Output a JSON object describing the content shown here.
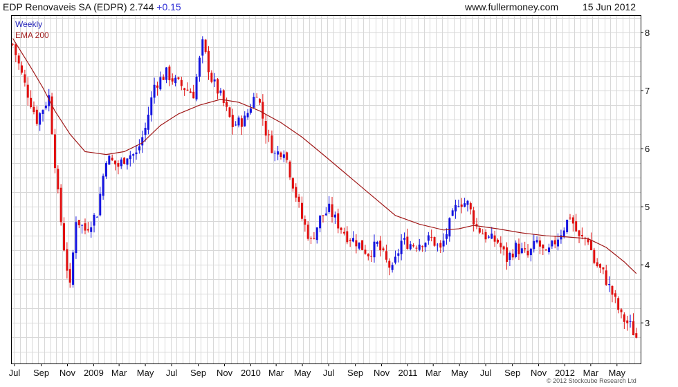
{
  "header": {
    "title": "EDP Renovaveis SA (EDPR) 2.744",
    "change": "+0.15",
    "site": "www.fullermoney.com",
    "date": "15 Jun 2012"
  },
  "legend": {
    "interval": "Weekly",
    "ema": "EMA 200"
  },
  "footer": {
    "copyright": "© 2012 Stockcube Research Ltd"
  },
  "colors": {
    "up": "#1414e0",
    "down": "#e01010",
    "ema": "#a01818",
    "grid": "#d8d8d8",
    "axis": "#000000"
  },
  "chart_data": {
    "type": "candlestick",
    "title": "EDP Renovaveis SA (EDPR) 2.744",
    "interval": "Weekly",
    "ylim": [
      2.3,
      8.3
    ],
    "y_ticks": [
      3,
      4,
      5,
      6,
      7,
      8
    ],
    "x_range": [
      "2008-06-23",
      "2012-06-25"
    ],
    "x_ticks": [
      {
        "label": "Jul",
        "date": "2008-07-01"
      },
      {
        "label": "Sep",
        "date": "2008-09-01"
      },
      {
        "label": "Nov",
        "date": "2008-11-01"
      },
      {
        "label": "2009",
        "date": "2009-01-01"
      },
      {
        "label": "Mar",
        "date": "2009-03-01"
      },
      {
        "label": "May",
        "date": "2009-05-01"
      },
      {
        "label": "Jul",
        "date": "2009-07-01"
      },
      {
        "label": "Sep",
        "date": "2009-09-01"
      },
      {
        "label": "Nov",
        "date": "2009-11-01"
      },
      {
        "label": "2010",
        "date": "2010-01-01"
      },
      {
        "label": "Mar",
        "date": "2010-03-01"
      },
      {
        "label": "May",
        "date": "2010-05-01"
      },
      {
        "label": "Jul",
        "date": "2010-07-01"
      },
      {
        "label": "Sep",
        "date": "2010-09-01"
      },
      {
        "label": "Nov",
        "date": "2010-11-01"
      },
      {
        "label": "2011",
        "date": "2011-01-01"
      },
      {
        "label": "Mar",
        "date": "2011-03-01"
      },
      {
        "label": "May",
        "date": "2011-05-01"
      },
      {
        "label": "Jul",
        "date": "2011-07-01"
      },
      {
        "label": "Sep",
        "date": "2011-09-01"
      },
      {
        "label": "Nov",
        "date": "2011-11-01"
      },
      {
        "label": "2012",
        "date": "2012-01-01"
      },
      {
        "label": "Mar",
        "date": "2012-03-01"
      },
      {
        "label": "May",
        "date": "2012-05-01"
      }
    ],
    "anchor_closes": [
      [
        "2008-06-27",
        7.8
      ],
      [
        "2008-07-25",
        7.1
      ],
      [
        "2008-08-22",
        6.5
      ],
      [
        "2008-09-19",
        6.9
      ],
      [
        "2008-10-10",
        5.2
      ],
      [
        "2008-10-24",
        4.3
      ],
      [
        "2008-11-07",
        3.6
      ],
      [
        "2008-11-21",
        4.8
      ],
      [
        "2008-12-12",
        4.6
      ],
      [
        "2009-01-09",
        4.9
      ],
      [
        "2009-01-30",
        5.85
      ],
      [
        "2009-02-27",
        5.7
      ],
      [
        "2009-03-20",
        5.9
      ],
      [
        "2009-04-10",
        5.9
      ],
      [
        "2009-05-01",
        6.35
      ],
      [
        "2009-05-22",
        7.1
      ],
      [
        "2009-06-19",
        7.3
      ],
      [
        "2009-07-10",
        7.15
      ],
      [
        "2009-07-31",
        7.05
      ],
      [
        "2009-08-21",
        6.95
      ],
      [
        "2009-09-11",
        7.8
      ],
      [
        "2009-10-02",
        7.2
      ],
      [
        "2009-10-23",
        6.9
      ],
      [
        "2009-11-20",
        6.4
      ],
      [
        "2009-12-18",
        6.5
      ],
      [
        "2010-01-15",
        7.0
      ],
      [
        "2010-02-05",
        6.3
      ],
      [
        "2010-02-26",
        5.9
      ],
      [
        "2010-03-19",
        6.0
      ],
      [
        "2010-04-09",
        5.4
      ],
      [
        "2010-04-30",
        4.8
      ],
      [
        "2010-05-21",
        4.4
      ],
      [
        "2010-06-11",
        4.8
      ],
      [
        "2010-07-02",
        4.95
      ],
      [
        "2010-07-23",
        4.7
      ],
      [
        "2010-08-13",
        4.5
      ],
      [
        "2010-09-03",
        4.4
      ],
      [
        "2010-10-01",
        4.2
      ],
      [
        "2010-10-22",
        4.35
      ],
      [
        "2010-11-12",
        4.05
      ],
      [
        "2010-11-26",
        3.9
      ],
      [
        "2010-12-17",
        4.4
      ],
      [
        "2011-01-14",
        4.35
      ],
      [
        "2011-02-04",
        4.4
      ],
      [
        "2011-02-25",
        4.45
      ],
      [
        "2011-03-18",
        4.25
      ],
      [
        "2011-04-08",
        4.7
      ],
      [
        "2011-04-29",
        5.1
      ],
      [
        "2011-05-20",
        5.05
      ],
      [
        "2011-06-10",
        4.65
      ],
      [
        "2011-07-08",
        4.45
      ],
      [
        "2011-07-29",
        4.4
      ],
      [
        "2011-08-19",
        4.1
      ],
      [
        "2011-09-09",
        4.3
      ],
      [
        "2011-10-07",
        4.15
      ],
      [
        "2011-10-28",
        4.4
      ],
      [
        "2011-11-18",
        4.15
      ],
      [
        "2011-12-09",
        4.4
      ],
      [
        "2011-12-30",
        4.65
      ],
      [
        "2012-01-13",
        4.85
      ],
      [
        "2012-02-03",
        4.45
      ],
      [
        "2012-02-24",
        4.45
      ],
      [
        "2012-03-09",
        4.05
      ],
      [
        "2012-03-30",
        3.85
      ],
      [
        "2012-04-20",
        3.5
      ],
      [
        "2012-05-11",
        3.1
      ],
      [
        "2012-06-01",
        2.95
      ],
      [
        "2012-06-15",
        2.744
      ]
    ],
    "ema_200": [
      [
        "2008-06-27",
        7.9
      ],
      [
        "2008-08-08",
        7.4
      ],
      [
        "2008-09-05",
        7.05
      ],
      [
        "2008-10-03",
        6.65
      ],
      [
        "2008-11-07",
        6.25
      ],
      [
        "2008-12-12",
        5.95
      ],
      [
        "2009-01-30",
        5.9
      ],
      [
        "2009-03-13",
        5.95
      ],
      [
        "2009-04-24",
        6.1
      ],
      [
        "2009-06-05",
        6.4
      ],
      [
        "2009-07-17",
        6.6
      ],
      [
        "2009-09-04",
        6.75
      ],
      [
        "2009-10-23",
        6.85
      ],
      [
        "2009-12-04",
        6.8
      ],
      [
        "2010-01-22",
        6.65
      ],
      [
        "2010-03-12",
        6.45
      ],
      [
        "2010-04-30",
        6.2
      ],
      [
        "2010-06-18",
        5.9
      ],
      [
        "2010-08-13",
        5.55
      ],
      [
        "2010-10-08",
        5.2
      ],
      [
        "2010-12-03",
        4.85
      ],
      [
        "2011-01-28",
        4.7
      ],
      [
        "2011-03-25",
        4.6
      ],
      [
        "2011-04-29",
        4.62
      ],
      [
        "2011-06-03",
        4.68
      ],
      [
        "2011-07-29",
        4.62
      ],
      [
        "2011-09-23",
        4.55
      ],
      [
        "2011-11-18",
        4.5
      ],
      [
        "2012-01-06",
        4.48
      ],
      [
        "2012-02-24",
        4.45
      ],
      [
        "2012-04-06",
        4.3
      ],
      [
        "2012-05-18",
        4.05
      ],
      [
        "2012-06-15",
        3.85
      ]
    ]
  }
}
